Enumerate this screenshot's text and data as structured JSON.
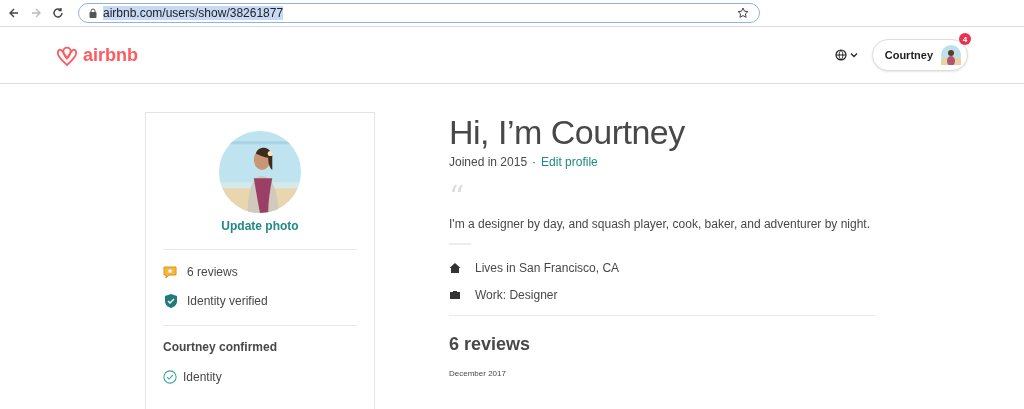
{
  "browser": {
    "url": "airbnb.com/users/show/38261877"
  },
  "header": {
    "logo": "airbnb",
    "user_button": {
      "label": "Courtney",
      "badge": "4"
    }
  },
  "sidebar": {
    "update_link": "Update photo",
    "badges": [
      {
        "kind": "reviews",
        "label": "6 reviews"
      },
      {
        "kind": "verified",
        "label": "Identity verified"
      }
    ],
    "confirmed_title": "Courtney confirmed",
    "confirmed": [
      {
        "label": "Identity",
        "checked": true
      }
    ]
  },
  "profile": {
    "title": "Hi, I’m Courtney",
    "joined": "Joined in 2015",
    "separator": "·",
    "edit_link": "Edit profile",
    "quote_mark": "“",
    "bio": "I'm a designer by day, and squash player, cook, baker, and adventurer by night.",
    "facts": [
      {
        "kind": "home",
        "label": "Lives in San Francisco, CA"
      },
      {
        "kind": "work",
        "label": "Work: Designer"
      }
    ],
    "reviews_title": "6 reviews",
    "review_date": "December 2017"
  }
}
